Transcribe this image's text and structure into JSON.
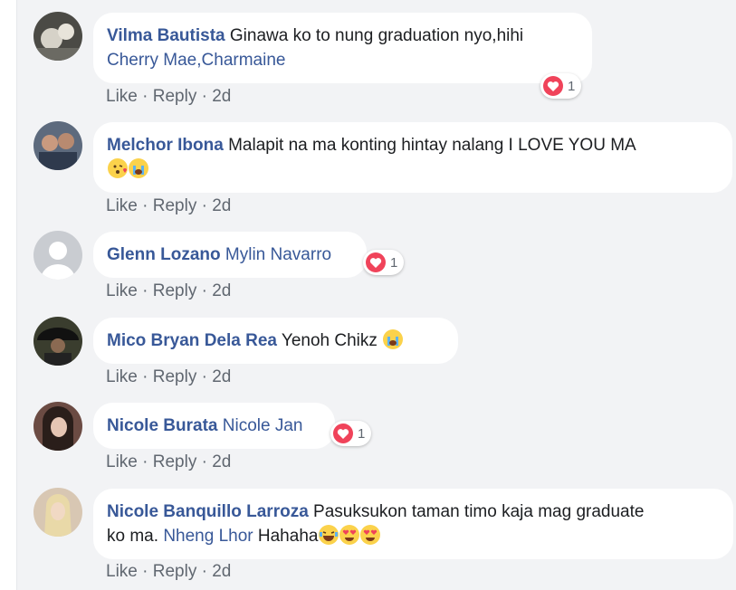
{
  "comments": [
    {
      "author": "Vilma Bautista",
      "text": "Ginawa ko to nung graduation nyo,hihi",
      "tag": "Cherry Mae,Charmaine",
      "like": "Like",
      "reply": "Reply",
      "time": "2d",
      "reactions": "1",
      "avatar_color": "#4b4a45"
    },
    {
      "author": "Melchor Ibona",
      "text": "Malapit na ma konting hintay nalang I LOVE YOU MA",
      "like": "Like",
      "reply": "Reply",
      "time": "2d",
      "emojis": [
        "kissing-heart-emoji",
        "crying-face-emoji"
      ],
      "avatar_color": "#5d6a7d"
    },
    {
      "author": "Glenn Lozano",
      "tag": "Mylin Navarro",
      "like": "Like",
      "reply": "Reply",
      "time": "2d",
      "reactions": "1",
      "avatar_color": "#c9ccd1"
    },
    {
      "author": "Mico Bryan Dela Rea",
      "text": "Yenoh Chikz",
      "like": "Like",
      "reply": "Reply",
      "time": "2d",
      "emojis": [
        "crying-face-emoji"
      ],
      "avatar_color": "#3a3d2e"
    },
    {
      "author": "Nicole Burata",
      "tag": "Nicole Jan",
      "like": "Like",
      "reply": "Reply",
      "time": "2d",
      "reactions": "1",
      "avatar_color": "#6b4b43"
    },
    {
      "author": "Nicole Banquillo Larroza",
      "text": "Pasuksukon taman timo kaja mag graduate",
      "text2": "ko ma.",
      "tag": "Nheng Lhor",
      "text3": "Hahaha",
      "emojis": [
        "laughing-face-emoji",
        "heart-eyes-emoji",
        "heart-eyes-emoji"
      ],
      "like": "Like",
      "reply": "Reply",
      "time": "2d",
      "avatar_color": "#d8c7b3"
    }
  ],
  "colors": {
    "author": "#385898",
    "text": "#1c1e21",
    "meta": "#606770",
    "heart": "#f0435a",
    "background": "#f2f3f5"
  }
}
